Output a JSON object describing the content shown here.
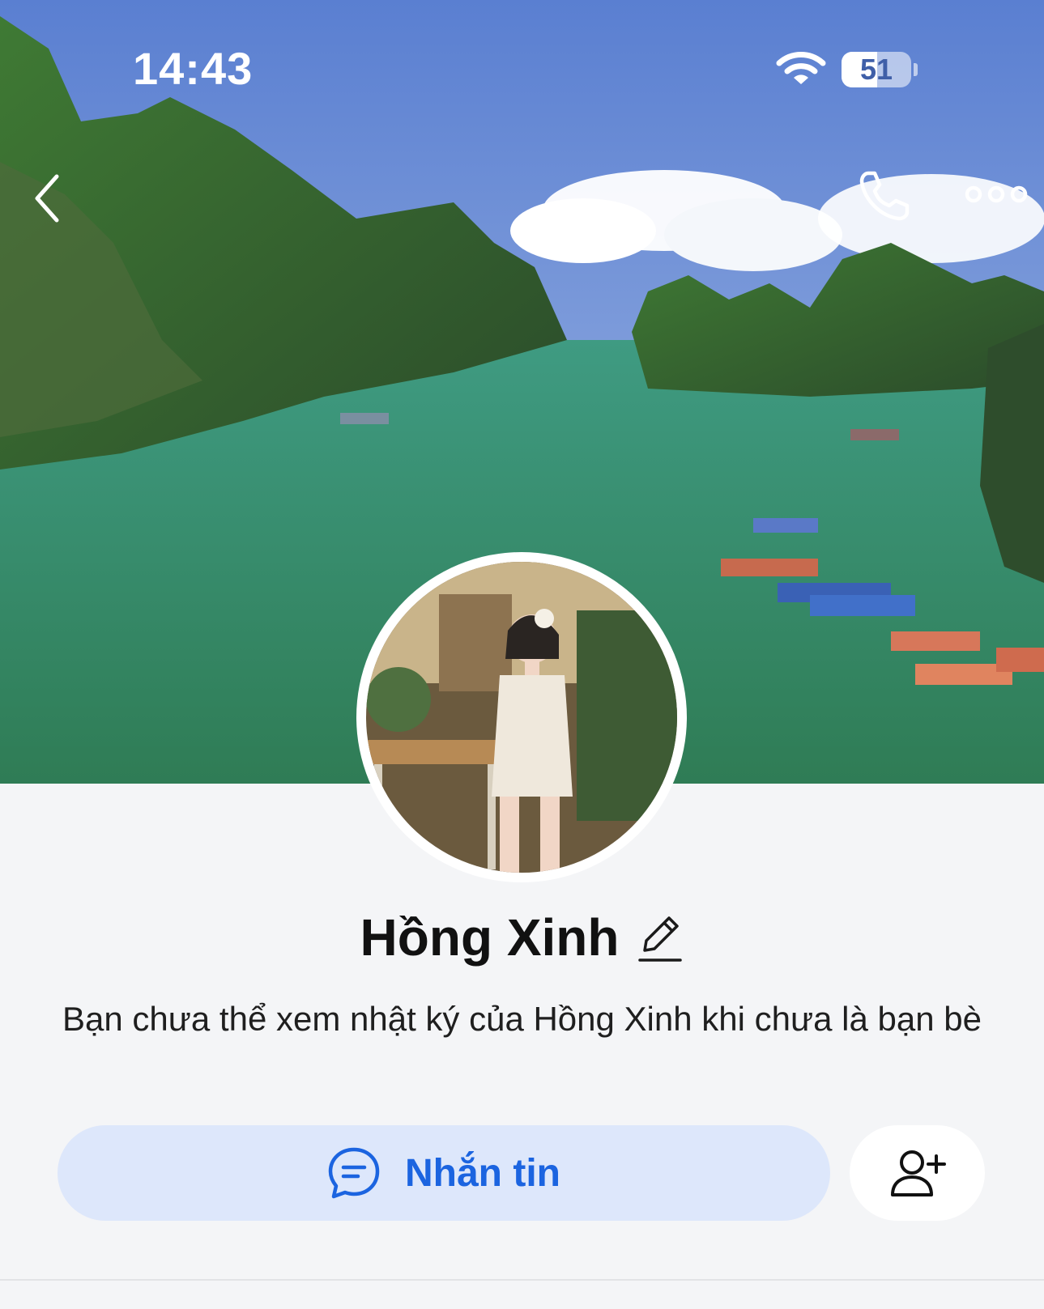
{
  "status_bar": {
    "time": "14:43",
    "battery_level": "51",
    "battery_fraction": 0.51,
    "wifi_icon": "wifi-icon"
  },
  "nav": {
    "back_icon": "chevron-left-icon",
    "call_icon": "phone-icon",
    "more_icon": "more-options-icon"
  },
  "profile": {
    "name": "Hồng Xinh",
    "edit_icon": "pencil-icon",
    "notice": "Bạn chưa thể xem nhật ký của Hồng Xinh khi chưa là bạn bè"
  },
  "actions": {
    "message_label": "Nhắn tin",
    "message_icon": "chat-bubble-icon",
    "add_friend_icon": "add-friend-icon"
  },
  "colors": {
    "accent": "#1b64e0",
    "button_bg": "#dde7fb",
    "background": "#f4f5f7"
  }
}
